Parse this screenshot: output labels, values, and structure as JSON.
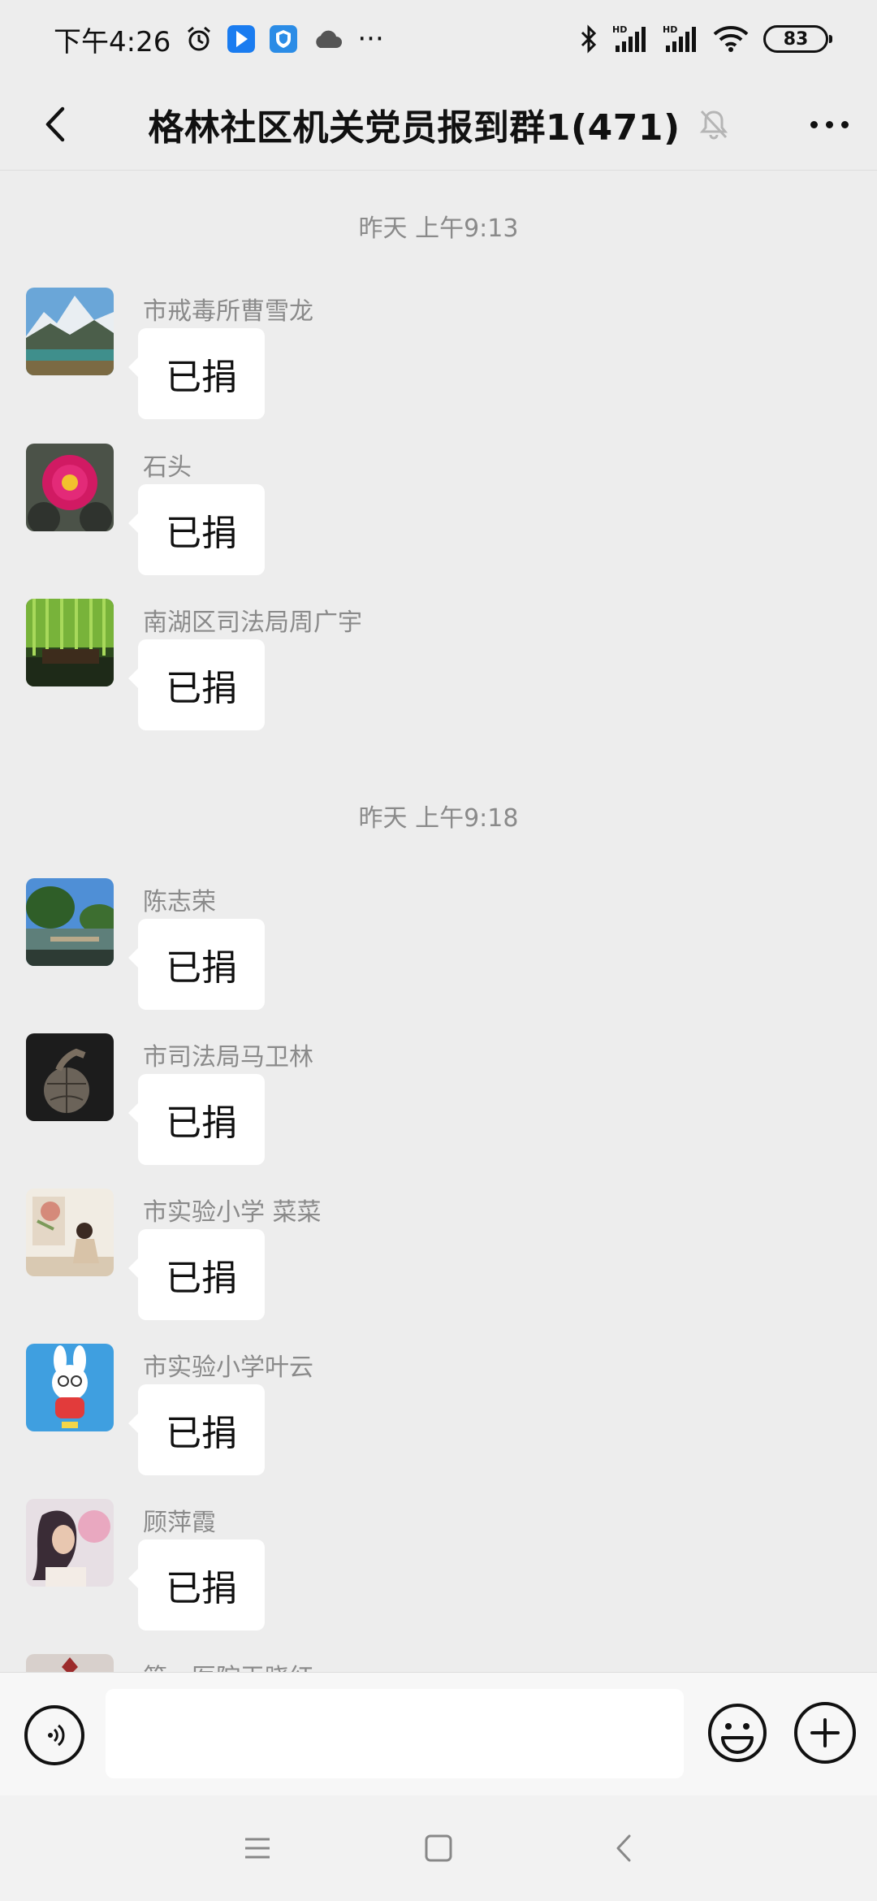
{
  "status_bar": {
    "time": "下午4:26",
    "more_indicator": "···",
    "battery": "83",
    "icons": [
      "alarm-icon",
      "app-notification-icon",
      "shield-app-icon",
      "cloud-icon",
      "bluetooth-icon",
      "hd-signal-icon",
      "hd-signal-icon",
      "wifi-icon",
      "battery-icon"
    ]
  },
  "header": {
    "title": "格林社区机关党员报到群1(471)",
    "icons": [
      "back-icon",
      "mute-bell-icon",
      "more-icon"
    ]
  },
  "chat": {
    "groups": [
      {
        "time": "昨天 上午9:13",
        "messages": [
          {
            "sender": "市戒毒所曹雪龙",
            "text": "已捐"
          },
          {
            "sender": "石头",
            "text": "已捐"
          },
          {
            "sender": "南湖区司法局周广宇",
            "text": "已捐"
          }
        ]
      },
      {
        "time": "昨天 上午9:18",
        "messages": [
          {
            "sender": "陈志荣",
            "text": "已捐"
          },
          {
            "sender": "市司法局马卫林",
            "text": "已捐"
          },
          {
            "sender": "市实验小学 菜菜",
            "text": "已捐"
          },
          {
            "sender": "市实验小学叶云",
            "text": "已捐"
          },
          {
            "sender": "顾萍霞",
            "text": "已捐"
          },
          {
            "sender": "第一医院王晓红",
            "text": ""
          }
        ]
      }
    ]
  },
  "input_bar": {
    "value": "",
    "placeholder": "",
    "icons": [
      "voice-icon",
      "emoji-icon",
      "plus-icon"
    ]
  },
  "nav_bar": {
    "icons": [
      "menu-icon",
      "home-icon",
      "back-nav-icon"
    ]
  },
  "colors": {
    "background": "#ededed",
    "bubble": "#ffffff",
    "secondary_text": "#8a8a8a"
  }
}
